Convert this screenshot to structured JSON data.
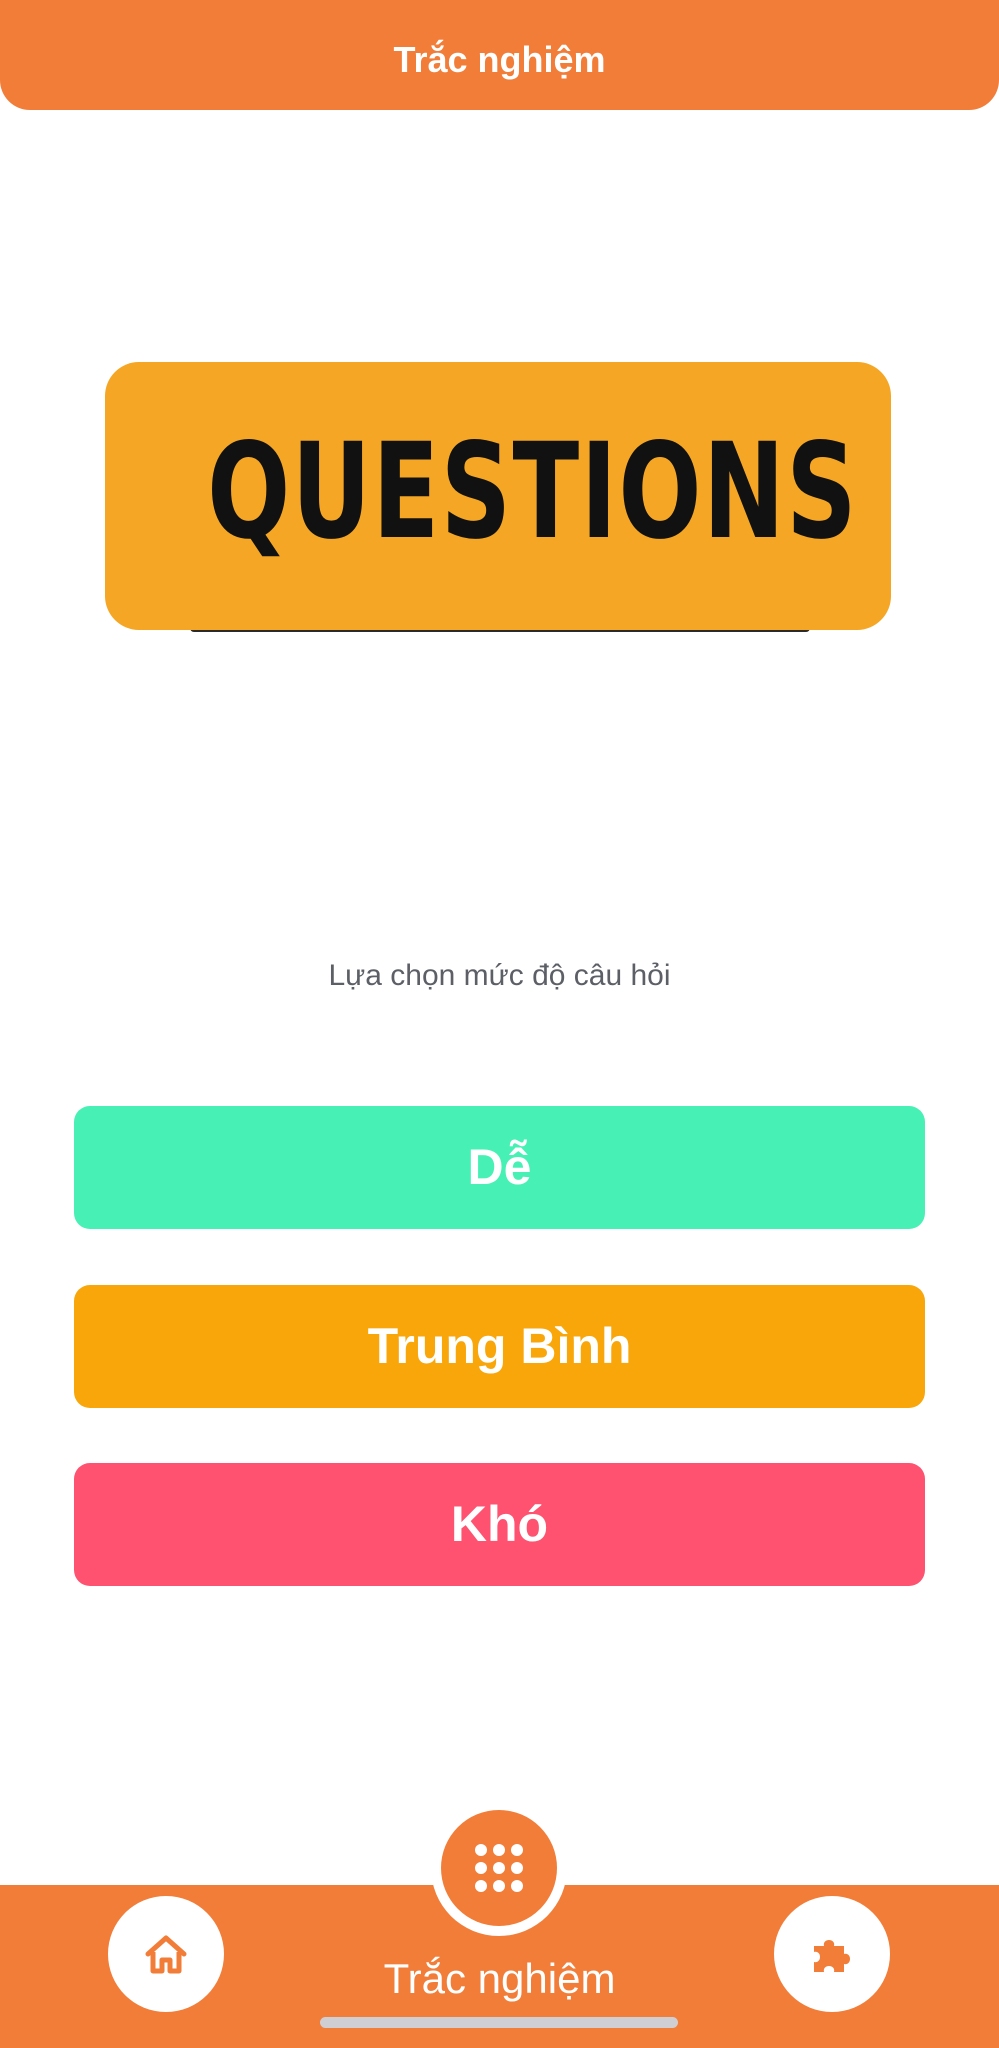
{
  "header": {
    "title": "Trắc nghiệm"
  },
  "hero": {
    "text": "QUESTIONS"
  },
  "main": {
    "subtitle": "Lựa chọn mức độ câu hỏi",
    "levels": [
      {
        "label": "Dễ",
        "color": "#47F0B4"
      },
      {
        "label": "Trung Bình",
        "color": "#F9A60A"
      },
      {
        "label": "Khó",
        "color": "#FE5270"
      }
    ]
  },
  "tabbar": {
    "label": "Trắc nghiệm",
    "left_icon": "home-icon",
    "center_icon": "grid-icon",
    "right_icon": "puzzle-icon",
    "color": "#F27D38"
  },
  "theme": {
    "accent": "#F27D38",
    "hero_bg": "#F4A624"
  }
}
